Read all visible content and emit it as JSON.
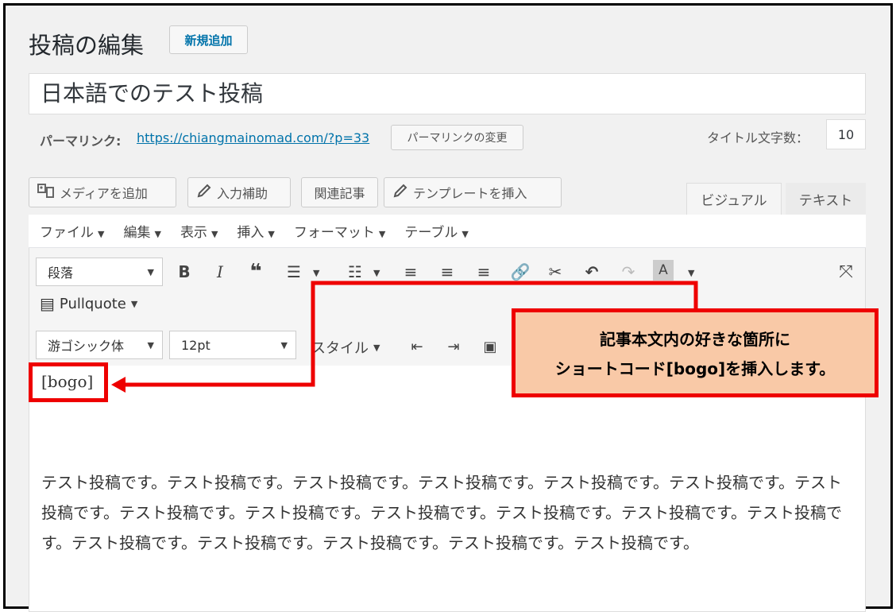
{
  "header": {
    "title": "投稿の編集",
    "add_new": "新規追加"
  },
  "post": {
    "title": "日本語でのテスト投稿"
  },
  "permalink": {
    "label": "パーマリンク:",
    "url": "https://chiangmainomad.com/?p=33",
    "change_button": "パーマリンクの変更"
  },
  "title_count": {
    "label": "タイトル文字数：",
    "value": "10"
  },
  "media_buttons": [
    {
      "label": "メディアを追加",
      "icon": "media-icon"
    },
    {
      "label": "入力補助",
      "icon": "pencil-icon"
    },
    {
      "label": "関連記事"
    },
    {
      "label": "テンプレートを挿入",
      "icon": "pencil-icon"
    }
  ],
  "tabs": {
    "visual": "ビジュアル",
    "text": "テキスト"
  },
  "menubar": [
    "ファイル",
    "編集",
    "表示",
    "挿入",
    "フォーマット",
    "テーブル"
  ],
  "toolbar": {
    "format_select": "段落",
    "pullquote": "Pullquote",
    "font_select": "游ゴシック体",
    "size_select": "12pt",
    "style_select": "スタイル"
  },
  "content": {
    "shortcode": "[bogo]",
    "paragraph": "テスト投稿です。テスト投稿です。テスト投稿です。テスト投稿です。テスト投稿です。テスト投稿です。テスト投稿です。テスト投稿です。テスト投稿です。テスト投稿です。テスト投稿です。テスト投稿です。テスト投稿です。テスト投稿です。テスト投稿です。テスト投稿です。テスト投稿です。テスト投稿です。"
  },
  "annotation": {
    "line1": "記事本文内の好きな箇所に",
    "line2": "ショートコード[bogo]を挿入します。"
  },
  "colors": {
    "link": "#0073aa",
    "annotation_border": "#ee0000",
    "annotation_fill": "#f9c9a7"
  }
}
